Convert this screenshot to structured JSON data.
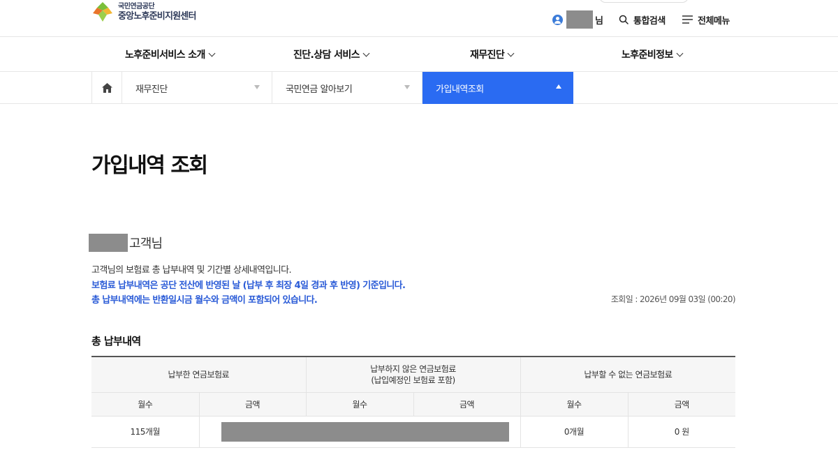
{
  "header": {
    "logo_line1": "국민연금공단",
    "logo_line2": "중앙노후준비지원센터",
    "user_suffix": "님",
    "search_label": "통합검색",
    "menu_label": "전체메뉴"
  },
  "nav": {
    "items": [
      {
        "label": "노후준비서비스 소개"
      },
      {
        "label": "진단.상담 서비스"
      },
      {
        "label": "재무진단"
      },
      {
        "label": "노후준비정보"
      }
    ]
  },
  "location": {
    "items": [
      {
        "label": "재무진단"
      },
      {
        "label": "국민연금 알아보기"
      },
      {
        "label": "가입내역조회"
      }
    ]
  },
  "content": {
    "title": "가입내역 조회",
    "customer_suffix": "고객님",
    "desc1": "고객님의 보험료 총 납부내역 및 기간별 상세내역입니다.",
    "desc2": "보험료 납부내역은 공단 전산에 반영된 날 (납부 후 최장 4일 경과 후 반영) 기준입니다.",
    "desc3": "총 납부내역에는 반환일시금 월수와 금액이 포함되어 있습니다.",
    "query_date": "조회일 : 2026년 09월 03일 (00:20)",
    "section_title": "총 납부내역"
  },
  "table": {
    "groups": [
      {
        "label": "납부한 연금보험료"
      },
      {
        "label_line1": "납부하지 않은 연금보험료",
        "label_line2": "(납입예정인 보험료 포함)"
      },
      {
        "label": "납부할 수 없는 연금보험료"
      }
    ],
    "subheaders": [
      "월수",
      "금액",
      "월수",
      "금액",
      "월수",
      "금액"
    ],
    "row": {
      "paid_months": "115개월",
      "not_payable_months": "0개월",
      "not_payable_amount": "0 원"
    }
  },
  "colors": {
    "accent": "#2a6bf2",
    "notice_text": "#2a5bd7",
    "redaction": "#8c8c8c"
  },
  "icons": {
    "user": "user-circle-icon",
    "search": "search-icon",
    "menu": "hamburger-icon",
    "home": "home-icon"
  }
}
